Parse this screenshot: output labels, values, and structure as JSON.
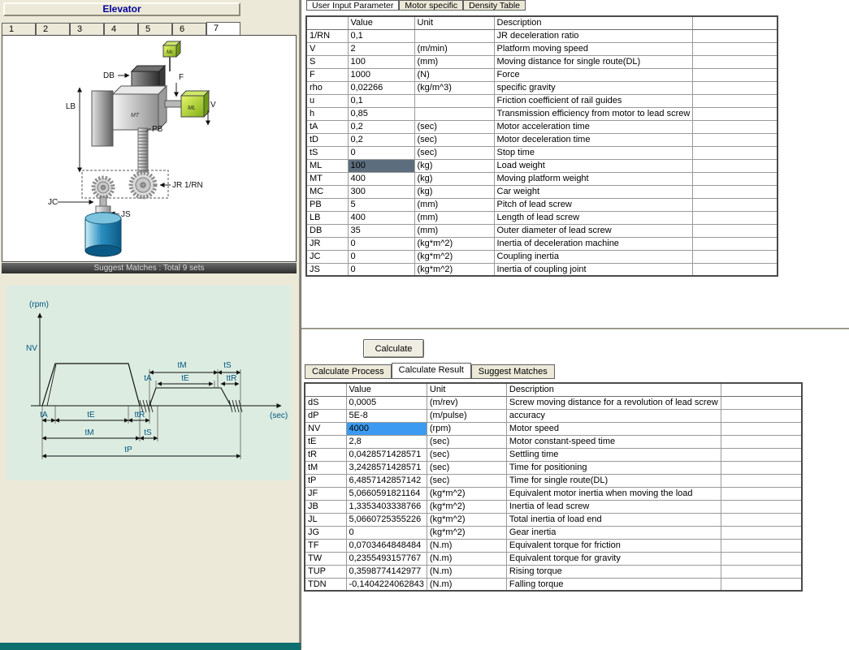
{
  "left": {
    "title": "Elevator",
    "tabs": [
      "1",
      "2",
      "3",
      "4",
      "5",
      "6",
      "7"
    ],
    "active_tab": "7",
    "status_bar": "Suggest Matches : Total  9 sets",
    "diagram": {
      "labels": {
        "db": "DB",
        "f": "F",
        "lb": "LB",
        "mt": "MT",
        "mc": "Mc",
        "ml": "ML",
        "v": "V",
        "pb": "PB",
        "jr": "JR 1/RN",
        "jc": "JC",
        "js": "JS"
      }
    },
    "chart": {
      "labels": {
        "rpm": "(rpm)",
        "sec": "(sec)",
        "nv": "NV",
        "ta": "tA",
        "te": "tE",
        "ttr": "ttR",
        "tm": "tM",
        "ts": "tS",
        "tp": "tP"
      }
    }
  },
  "right": {
    "top_tabs": [
      {
        "label": "User Input Parameter",
        "active": true
      },
      {
        "label": "Motor specific",
        "active": false
      },
      {
        "label": "Density Table",
        "active": false
      }
    ],
    "input_table": {
      "headers": [
        "",
        "Value",
        "Unit",
        "Description",
        ""
      ],
      "rows": [
        {
          "name": "1/RN",
          "value": "0,1",
          "unit": "",
          "desc": "JR deceleration ratio"
        },
        {
          "name": "V",
          "value": "2",
          "unit": "(m/min)",
          "desc": "Platform moving speed"
        },
        {
          "name": "S",
          "value": "100",
          "unit": "(mm)",
          "desc": "Moving distance for single route(DL)"
        },
        {
          "name": "F",
          "value": "1000",
          "unit": "(N)",
          "desc": "Force"
        },
        {
          "name": "rho",
          "value": "0,02266",
          "unit": "(kg/m^3)",
          "desc": "specific gravity"
        },
        {
          "name": "u",
          "value": "0,1",
          "unit": "",
          "desc": "Friction coefficient of rail guides"
        },
        {
          "name": "h",
          "value": "0,85",
          "unit": "",
          "desc": "Transmission efficiency from motor to lead screw"
        },
        {
          "name": "tA",
          "value": "0,2",
          "unit": "(sec)",
          "desc": "Motor acceleration time"
        },
        {
          "name": "tD",
          "value": "0,2",
          "unit": "(sec)",
          "desc": "Motor deceleration time"
        },
        {
          "name": "tS",
          "value": "0",
          "unit": "(sec)",
          "desc": "Stop time"
        },
        {
          "name": "ML",
          "value": "100",
          "unit": "(kg)",
          "desc": "Load weight",
          "selected": "dark"
        },
        {
          "name": "MT",
          "value": "400",
          "unit": "(kg)",
          "desc": "Moving platform weight"
        },
        {
          "name": "MC",
          "value": "300",
          "unit": "(kg)",
          "desc": "Car weight"
        },
        {
          "name": "PB",
          "value": "5",
          "unit": "(mm)",
          "desc": "Pitch of lead screw"
        },
        {
          "name": "LB",
          "value": "400",
          "unit": "(mm)",
          "desc": "Length of lead screw"
        },
        {
          "name": "DB",
          "value": "35",
          "unit": "(mm)",
          "desc": "Outer diameter of lead screw"
        },
        {
          "name": "JR",
          "value": "0",
          "unit": "(kg*m^2)",
          "desc": "Inertia of deceleration machine"
        },
        {
          "name": "JC",
          "value": "0",
          "unit": "(kg*m^2)",
          "desc": "Coupling inertia"
        },
        {
          "name": "JS",
          "value": "0",
          "unit": "(kg*m^2)",
          "desc": "Inertia of coupling joint"
        }
      ]
    },
    "calculate_button_label": "Calculate",
    "result_tabs": [
      {
        "label": "Calculate Process",
        "active": false
      },
      {
        "label": "Calculate Result",
        "active": true
      },
      {
        "label": "Suggest Matches",
        "active": false
      }
    ],
    "result_table": {
      "headers": [
        "",
        "Value",
        "Unit",
        "Description",
        ""
      ],
      "rows": [
        {
          "name": "dS",
          "value": "0,0005",
          "unit": "(m/rev)",
          "desc": "Screw moving distance for a revolution of lead screw"
        },
        {
          "name": "dP",
          "value": "5E-8",
          "unit": "(m/pulse)",
          "desc": "accuracy"
        },
        {
          "name": "NV",
          "value": "4000",
          "unit": "(rpm)",
          "desc": "Motor speed",
          "selected": "blue"
        },
        {
          "name": "tE",
          "value": "2,8",
          "unit": "(sec)",
          "desc": "Motor constant-speed time"
        },
        {
          "name": "tR",
          "value": "0,0428571428571",
          "unit": "(sec)",
          "desc": "Settling time"
        },
        {
          "name": "tM",
          "value": "3,2428571428571",
          "unit": "(sec)",
          "desc": "Time for positioning"
        },
        {
          "name": "tP",
          "value": "6,4857142857142",
          "unit": "(sec)",
          "desc": "Time for single route(DL)"
        },
        {
          "name": "JF",
          "value": "5,0660591821164",
          "unit": "(kg*m^2)",
          "desc": "Equivalent motor inertia when moving the load"
        },
        {
          "name": "JB",
          "value": "1,3353403338766",
          "unit": "(kg*m^2)",
          "desc": "Inertia of lead screw"
        },
        {
          "name": "JL",
          "value": "5,0660725355226",
          "unit": "(kg*m^2)",
          "desc": "Total inertia of load end"
        },
        {
          "name": "JG",
          "value": "0",
          "unit": "(kg*m^2)",
          "desc": "Gear inertia"
        },
        {
          "name": "TF",
          "value": "0,0703464848484",
          "unit": "(N.m)",
          "desc": "Equivalent torque for friction"
        },
        {
          "name": "TW",
          "value": "0,2355493157767",
          "unit": "(N.m)",
          "desc": "Equivalent torque for gravity"
        },
        {
          "name": "TUP",
          "value": "0,3598774142977",
          "unit": "(N.m)",
          "desc": "Rising torque"
        },
        {
          "name": "TDN",
          "value": "-0,1404224062843",
          "unit": "(N.m)",
          "desc": "Falling torque"
        }
      ]
    }
  }
}
